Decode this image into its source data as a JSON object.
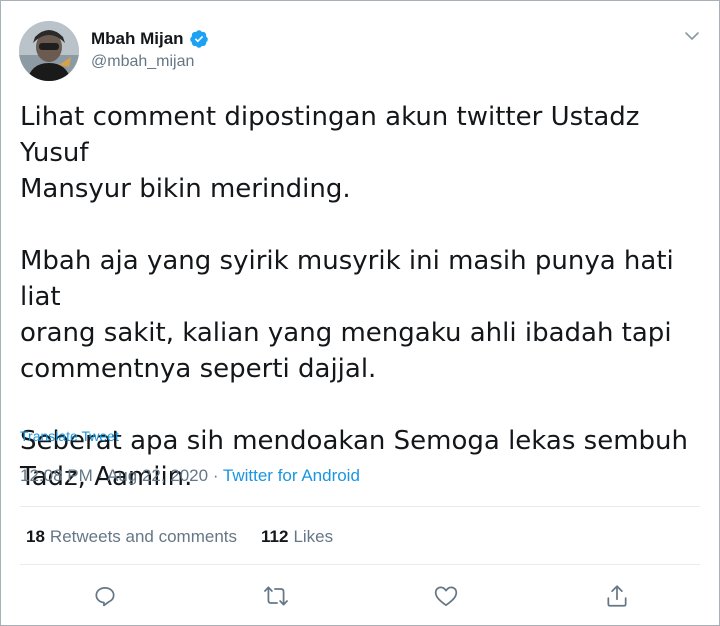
{
  "author": {
    "display_name": "Mbah Mijan",
    "handle": "@mbah_mijan",
    "verified": true,
    "verified_color": "#1da1f2"
  },
  "tweet": {
    "text": "Lihat comment dipostingan akun twitter Ustadz Yusuf\nMansyur bikin merinding.\n\nMbah aja yang syirik musyrik ini masih punya hati liat\norang sakit, kalian yang mengaku ahli ibadah tapi\ncommentnya seperti dajjal.\n\nSeberat apa sih mendoakan Semoga lekas sembuh\nTadz, Aamiin.",
    "translate_label": "Translate Tweet",
    "time": "12:08 PM",
    "separator": " · ",
    "date": "Aug 22, 2020",
    "source": "Twitter for Android"
  },
  "stats": {
    "retweets_count": "18",
    "retweets_label": "Retweets and comments",
    "likes_count": "112",
    "likes_label": "Likes"
  },
  "actions": [
    {
      "icon": "reply-icon"
    },
    {
      "icon": "retweet-icon"
    },
    {
      "icon": "like-icon"
    },
    {
      "icon": "share-icon"
    }
  ],
  "colors": {
    "link": "#1b95e0",
    "secondary_text": "#657786",
    "primary_text": "#14171a"
  }
}
